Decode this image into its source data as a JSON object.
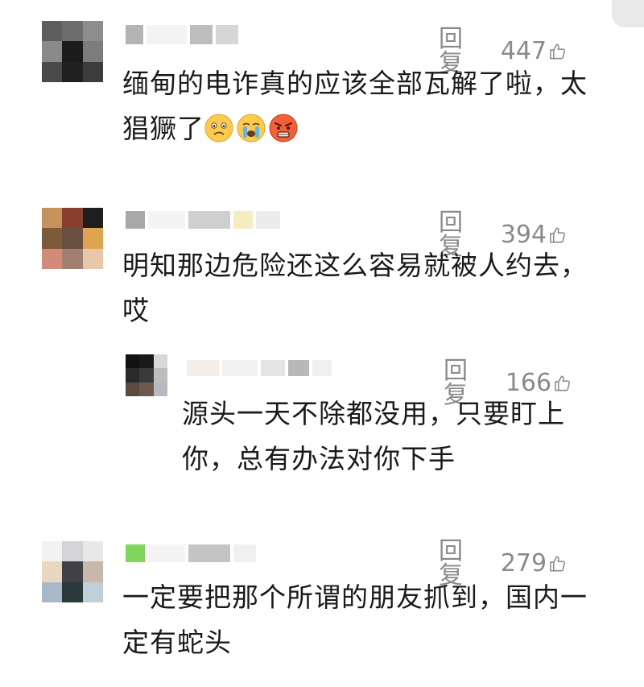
{
  "reply_label": "回复",
  "comments": [
    {
      "id": "c1",
      "likes": "447",
      "text_line1": "缅甸的电诈真的应该全部瓦解了啦，太",
      "text_line2": "猖獗了",
      "emojis": [
        "worried-face-icon",
        "crying-face-icon",
        "angry-face-icon"
      ]
    },
    {
      "id": "c2",
      "likes": "394",
      "text_line1": "明知那边危险还这么容易就被人约去，",
      "text_line2": "哎"
    },
    {
      "id": "c2r1",
      "likes": "166",
      "text_line1": "源头一天不除都没用，只要盯上",
      "text_line2": "你，总有办法对你下手"
    },
    {
      "id": "c3",
      "likes": "279",
      "text_line1": "一定要把那个所谓的朋友抓到，国内一",
      "text_line2": "定有蛇头"
    }
  ],
  "colors": {
    "action_gray": "#8a8a8a",
    "text": "#1a1a1a",
    "background": "#ffffff"
  }
}
